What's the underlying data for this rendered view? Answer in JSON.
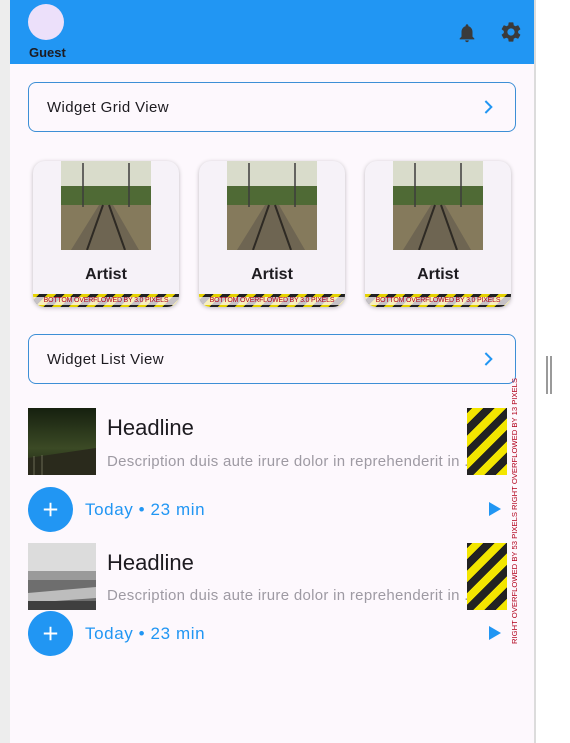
{
  "header": {
    "user_name": "Guest"
  },
  "grid_section": {
    "label": "Widget Grid View"
  },
  "grid_cards": [
    {
      "title": "Artist",
      "overflow_text": "BOTTOM OVERFLOWED BY 3.0 PIXELS"
    },
    {
      "title": "Artist",
      "overflow_text": "BOTTOM OVERFLOWED BY 3.0 PIXELS"
    },
    {
      "title": "Artist",
      "overflow_text": "BOTTOM OVERFLOWED BY 3.0 PIXELS"
    }
  ],
  "list_section": {
    "label": "Widget List View"
  },
  "list_items": [
    {
      "headline": "Headline",
      "description": "Description duis aute irure dolor in reprehenderit in ...",
      "meta": "Today • 23 min"
    },
    {
      "headline": "Headline",
      "description": "Description duis aute irure dolor in reprehenderit in ...",
      "meta": "Today • 23 min"
    }
  ],
  "overflow_vertical_text": "RIGHT OVERFLOWED BY 53 PIXELS RIGHT OVERFLOWED BY 13 PIXELS",
  "colors": {
    "primary": "#2196f3",
    "overflow_red": "#b1001b",
    "stripe_yellow": "#f3e600"
  }
}
